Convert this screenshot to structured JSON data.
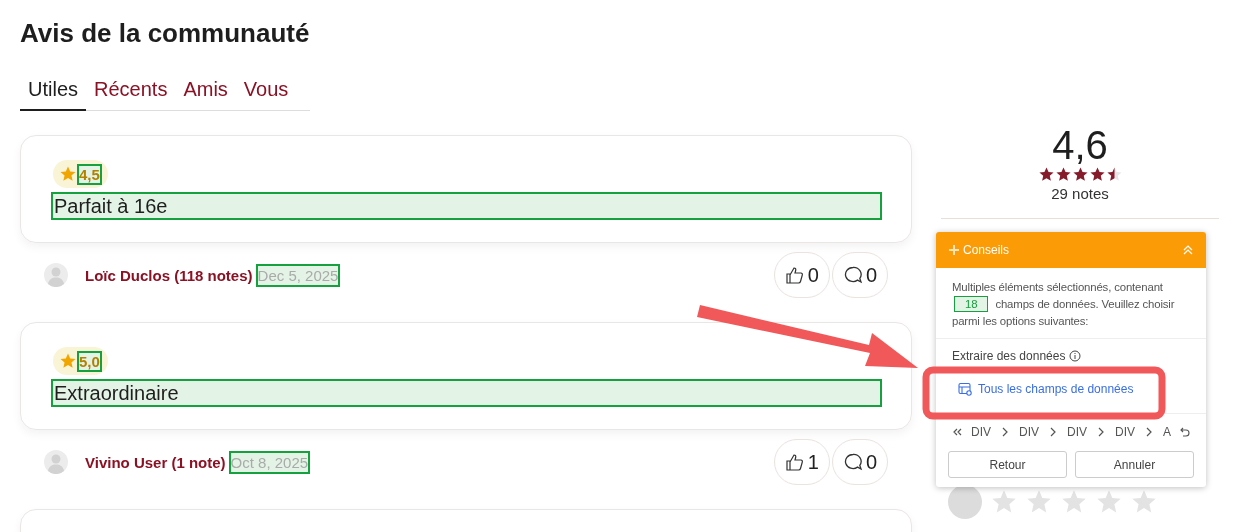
{
  "title": "Avis de la communauté",
  "tabs": [
    {
      "label": "Utiles",
      "selected": true
    },
    {
      "label": "Récents",
      "selected": false
    },
    {
      "label": "Amis",
      "selected": false
    },
    {
      "label": "Vous",
      "selected": false
    }
  ],
  "reviews": [
    {
      "rating": "4,5",
      "text": "Parfait à 16e",
      "author": "Loïc Duclos (118 notes)",
      "date": "Dec 5, 2025",
      "likes": "0",
      "comments": "0",
      "highlighted": true
    },
    {
      "rating": "5,0",
      "text": "Extraordinaire",
      "author": "Vivino User (1 note)",
      "date": "Oct 8, 2025",
      "likes": "1",
      "comments": "0",
      "highlighted": true
    }
  ],
  "summary": {
    "average": "4,6",
    "stars": 4.5,
    "count": "29 notes"
  },
  "my_rating": {
    "stars": 0
  },
  "panel": {
    "title": "Conseils",
    "message_before": "Multiples éléments sélectionnés, contenant",
    "count": "18",
    "message_after": "champs de données. Veuillez choisir parmi les options suivantes:",
    "section": "Extraire des données",
    "option": "Tous les champs de données",
    "breadcrumb": [
      "DIV",
      "DIV",
      "DIV",
      "DIV",
      "A"
    ],
    "buttons": [
      "Retour",
      "Annuler"
    ]
  }
}
